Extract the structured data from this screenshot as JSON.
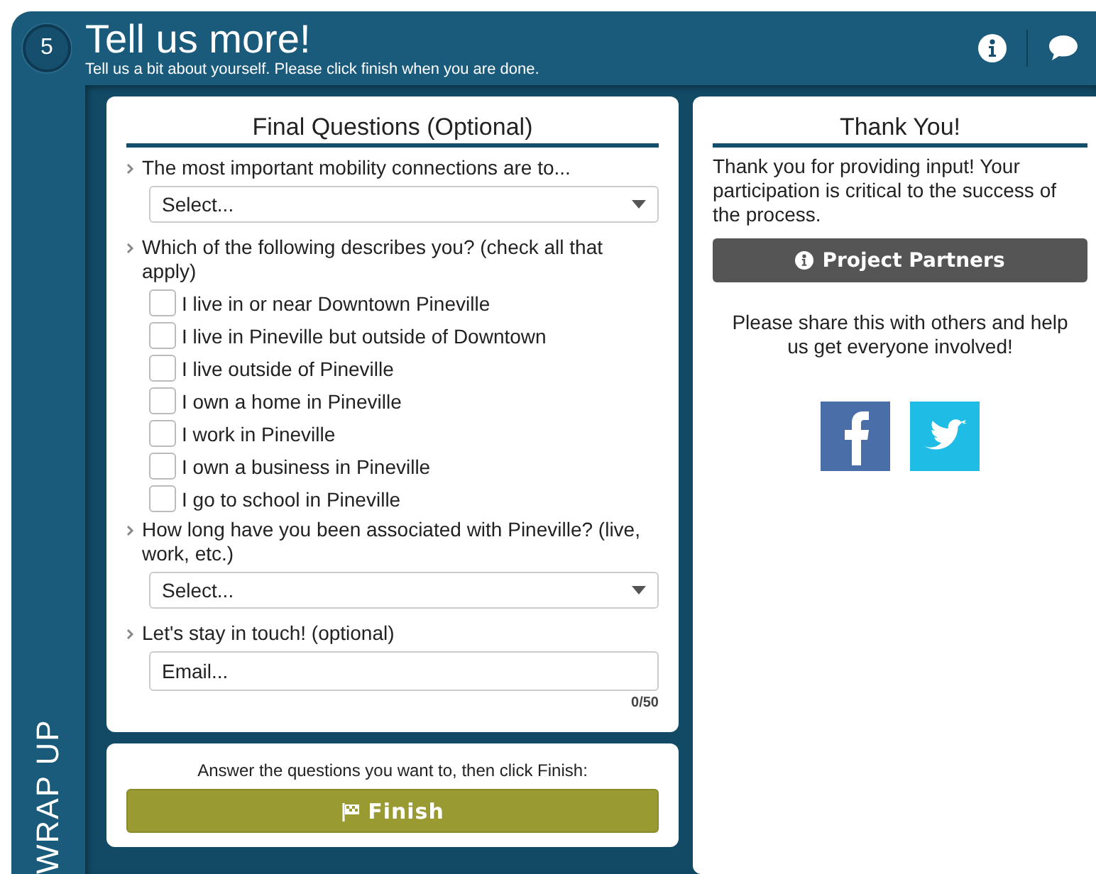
{
  "header": {
    "step": "5",
    "title": "Tell us more!",
    "subtitle": "Tell us a bit about yourself. Please click finish when you are done."
  },
  "sidebar": {
    "label": "WRAP UP"
  },
  "questions_card": {
    "title": "Final Questions (Optional)",
    "questions": [
      {
        "kind": "select",
        "label": "The most important mobility connections are to...",
        "value": "Select..."
      },
      {
        "kind": "checkboxes",
        "label": "Which of the following describes you? (check all that apply)",
        "options": [
          {
            "label": "I live in or near Downtown Pineville",
            "checked": false
          },
          {
            "label": "I live in Pineville but outside of Downtown",
            "checked": false
          },
          {
            "label": "I live outside of Pineville",
            "checked": false
          },
          {
            "label": "I own a home in Pineville",
            "checked": false
          },
          {
            "label": "I work in Pineville",
            "checked": false
          },
          {
            "label": "I own a business in Pineville",
            "checked": false
          },
          {
            "label": "I go to school in Pineville",
            "checked": false
          }
        ]
      },
      {
        "kind": "select",
        "label": "How long have you been associated with Pineville? (live, work, etc.)",
        "value": "Select..."
      },
      {
        "kind": "text",
        "label": "Let's stay in touch! (optional)",
        "placeholder": "Email...",
        "counter": "0/50"
      }
    ]
  },
  "finish_card": {
    "prompt": "Answer the questions you want to, then click Finish:",
    "button": "Finish"
  },
  "thanks_card": {
    "title": "Thank You!",
    "message": "Thank you for providing input! Your participation is critical to the success of the process.",
    "partners_button": "Project Partners",
    "share_text": "Please share this with others and help us get everyone involved!"
  }
}
